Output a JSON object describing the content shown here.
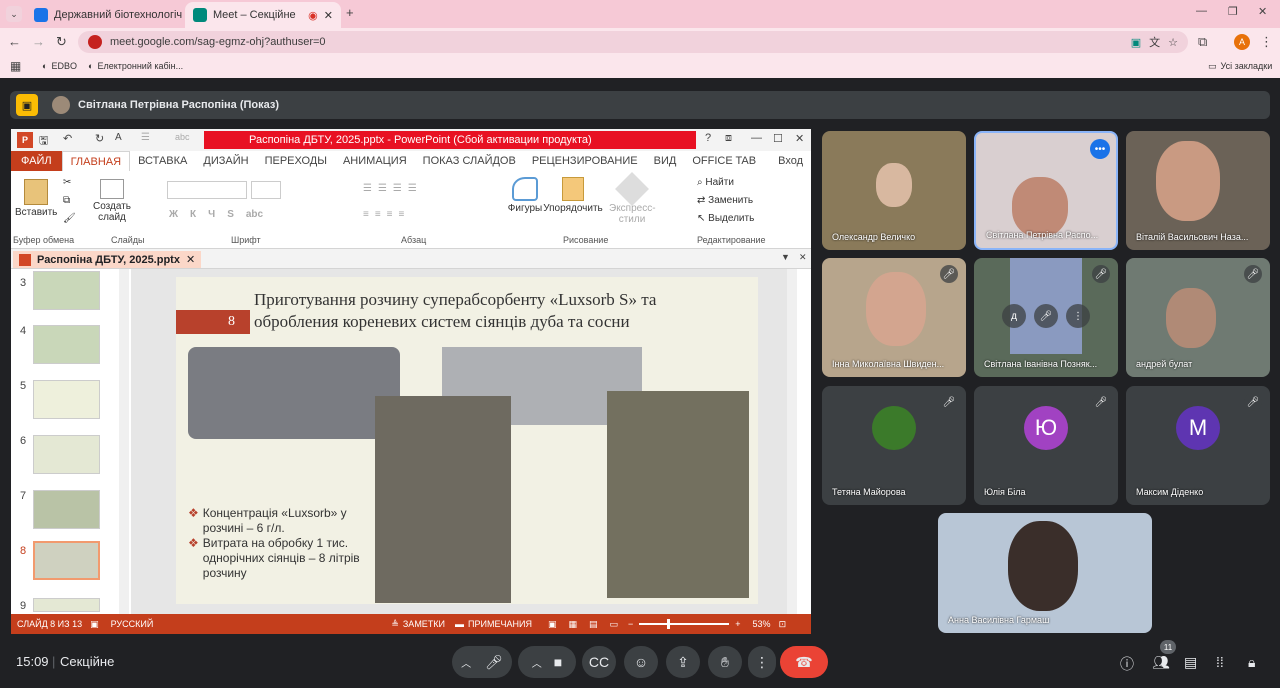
{
  "browser": {
    "tabs": [
      {
        "title": "Державний біотехнологічний",
        "favicon_color": "#1a73e8"
      },
      {
        "title": "Meet – Секційне",
        "favicon_color": "#00897b"
      }
    ],
    "url": "meet.google.com/sag-egmz-ohj?authuser=0",
    "bookmarks": [
      "EDBO",
      "Електронний кабін..."
    ],
    "all_bookmarks": "Усі закладки",
    "profile_letter": "A"
  },
  "meet": {
    "presenter": "Світлана Петрівна Распопіна (Показ)",
    "time": "15:09",
    "meeting_name": "Секційне",
    "participants_count": "11"
  },
  "ppt": {
    "window_title": "Распопіна ДБТУ, 2025.pptx - PowerPoint (Сбой активации продукта)",
    "tabs": [
      "ФАЙЛ",
      "ГЛАВНАЯ",
      "ВСТАВКА",
      "ДИЗАЙН",
      "ПЕРЕХОДЫ",
      "АНИМАЦИЯ",
      "ПОКАЗ СЛАЙДОВ",
      "РЕЦЕНЗИРОВАНИЕ",
      "ВИД",
      "OFFICE TAB"
    ],
    "signin": "Вход",
    "groups": [
      "Буфер обмена",
      "Слайды",
      "Шрифт",
      "Абзац",
      "Рисование",
      "Редактирование"
    ],
    "buttons": {
      "paste": "Вставить",
      "create_slide": "Создать слайд",
      "shapes": "Фигуры",
      "arrange": "Упорядочить",
      "quick_styles": "Экспресс-стили",
      "find": "Найти",
      "replace": "Заменить",
      "select": "Выделить"
    },
    "font_tools": [
      "Ж",
      "К",
      "Ч",
      "S",
      "abc"
    ],
    "doc_tab": "Распопіна ДБТУ, 2025.pptx",
    "thumb_numbers": [
      "3",
      "4",
      "5",
      "6",
      "7",
      "8",
      "9"
    ],
    "slide": {
      "number": "8",
      "title": "Приготування розчину суперабсорбенту «Luxsorb S» та обробления кореневих систем сіянців дуба та сосни",
      "bullets": [
        "Концентрація «Luxsorb» у розчині – 6 г/л.",
        "Витрата на обробку 1 тис. однорічних сіянців – 8 літрів розчину"
      ]
    },
    "status": {
      "slide": "СЛАЙД 8 ИЗ 13",
      "lang": "РУССКИЙ",
      "notes": "ЗАМЕТКИ",
      "comments": "ПРИМЕЧАНИЯ",
      "zoom": "53%"
    }
  },
  "tiles": [
    {
      "name": "Олександр Величко",
      "muted": false,
      "bg": "#8a7a5a"
    },
    {
      "name": "Світлана Петрівна Распо...",
      "muted": false,
      "bg": "#d9cfd0"
    },
    {
      "name": "Віталій Васильович Наза...",
      "muted": false,
      "bg": "#6b6257"
    },
    {
      "name": "Інна Миколаївна Швиден...",
      "muted": true,
      "bg": "#b7a58c"
    },
    {
      "name": "Світлана Іванівна Позняк...",
      "muted": true,
      "bg": "#5a6a5a"
    },
    {
      "name": "андрей булат",
      "muted": true,
      "bg": "#6f7a72"
    },
    {
      "name": "Тетяна Майорова",
      "muted": true,
      "avatar": "",
      "avatar_color": "#3b7a2a"
    },
    {
      "name": "Юлія Біла",
      "muted": true,
      "avatar": "Ю",
      "avatar_color": "#a142c2"
    },
    {
      "name": "Максим Діденко",
      "muted": true,
      "avatar": "М",
      "avatar_color": "#5e35b1"
    },
    {
      "name": "Анна Василівна Гармаш",
      "muted": false,
      "bg": "#b8c6d6"
    }
  ],
  "colors": {
    "ppt_accent": "#c43e1c",
    "end_call": "#ea4335",
    "meet_bg": "#202124"
  }
}
